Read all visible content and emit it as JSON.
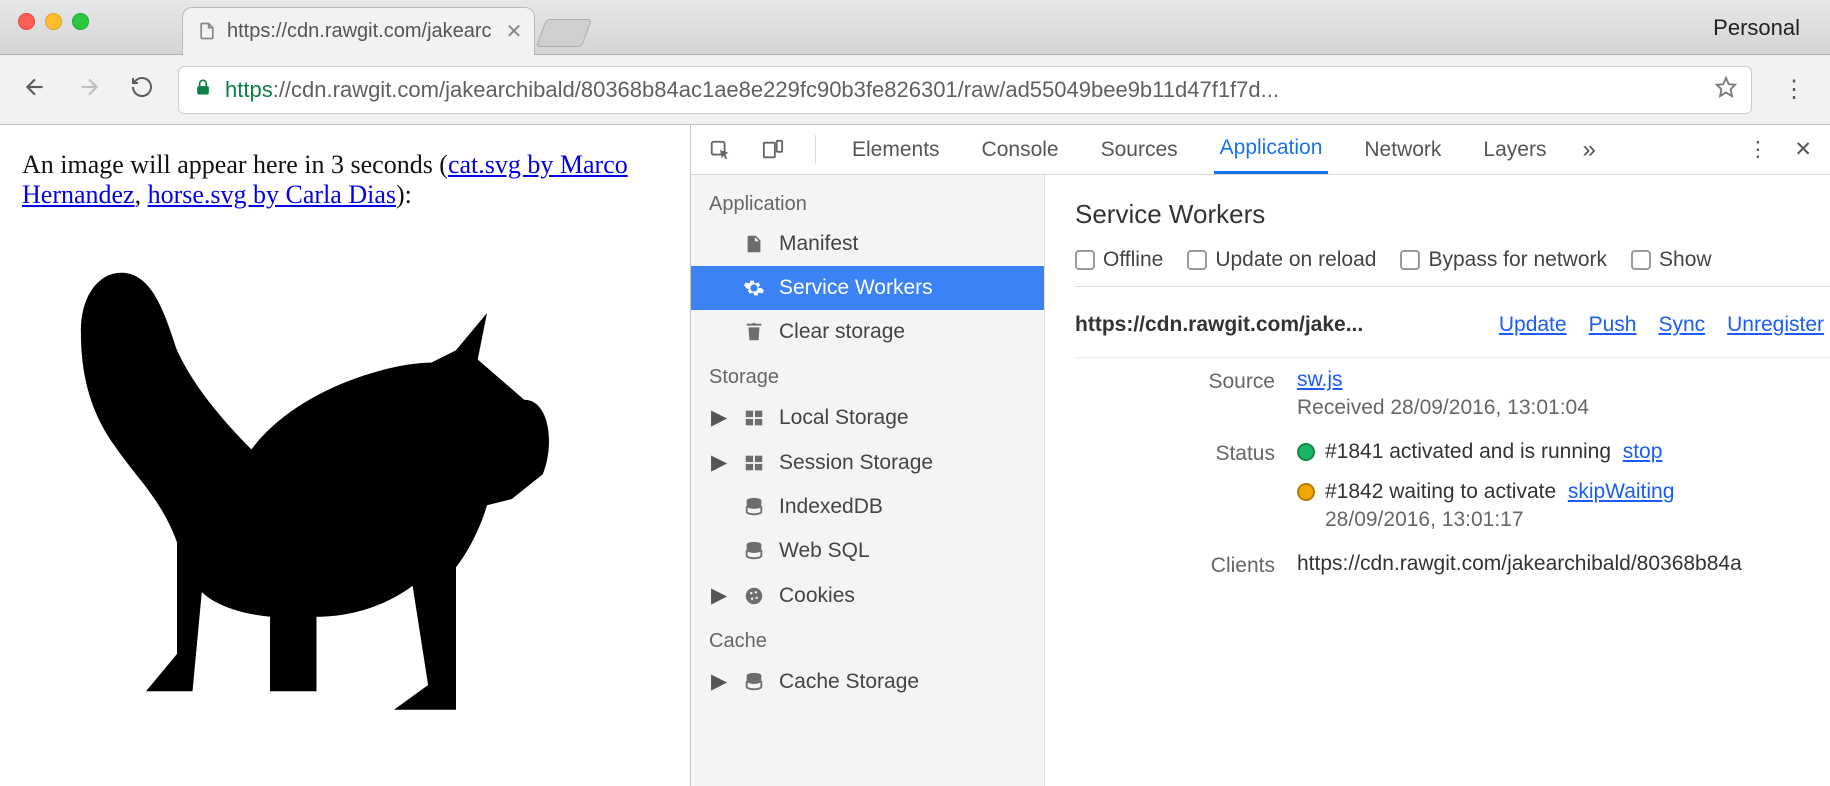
{
  "window": {
    "profile_label": "Personal",
    "tab_title": "https://cdn.rawgit.com/jakearc",
    "url_scheme": "https",
    "url_host": "://cdn.rawgit.com",
    "url_path": "/jakearchibald/80368b84ac1ae8e229fc90b3fe826301/raw/ad55049bee9b11d47f1f7d..."
  },
  "page": {
    "intro_a": "An image will appear here in 3 seconds (",
    "link1": "cat.svg by Marco Hernandez",
    "sep": ", ",
    "link2": "horse.svg by Carla Dias",
    "intro_b": "):"
  },
  "devtools": {
    "tabs": [
      "Elements",
      "Console",
      "Sources",
      "Application",
      "Network",
      "Layers"
    ],
    "active_tab_index": 3,
    "sidebar": {
      "groups": [
        {
          "title": "Application",
          "items": [
            {
              "name": "manifest",
              "label": "Manifest",
              "icon": "file"
            },
            {
              "name": "service-workers",
              "label": "Service Workers",
              "icon": "gear",
              "selected": true
            },
            {
              "name": "clear-storage",
              "label": "Clear storage",
              "icon": "trash"
            }
          ]
        },
        {
          "title": "Storage",
          "items": [
            {
              "name": "local-storage",
              "label": "Local Storage",
              "icon": "grid",
              "expand": true
            },
            {
              "name": "session-storage",
              "label": "Session Storage",
              "icon": "grid",
              "expand": true
            },
            {
              "name": "indexeddb",
              "label": "IndexedDB",
              "icon": "db"
            },
            {
              "name": "web-sql",
              "label": "Web SQL",
              "icon": "db"
            },
            {
              "name": "cookies",
              "label": "Cookies",
              "icon": "cookie",
              "expand": true
            }
          ]
        },
        {
          "title": "Cache",
          "items": [
            {
              "name": "cache-storage",
              "label": "Cache Storage",
              "icon": "db",
              "expand": true
            }
          ]
        }
      ]
    },
    "sw": {
      "title": "Service Workers",
      "toolbar": {
        "offline": "Offline",
        "update_on_reload": "Update on reload",
        "bypass": "Bypass for network",
        "show": "Show"
      },
      "scope": "https://cdn.rawgit.com/jake...",
      "actions": {
        "update": "Update",
        "push": "Push",
        "sync": "Sync",
        "unregister": "Unregister"
      },
      "source_label": "Source",
      "source_link": "sw.js",
      "source_received": "Received 28/09/2016, 13:01:04",
      "status_label": "Status",
      "status1_text": "#1841 activated and is running",
      "status1_action": "stop",
      "status2_text": "#1842 waiting to activate",
      "status2_action": "skipWaiting",
      "status2_time": "28/09/2016, 13:01:17",
      "clients_label": "Clients",
      "clients_value": "https://cdn.rawgit.com/jakearchibald/80368b84a"
    }
  }
}
